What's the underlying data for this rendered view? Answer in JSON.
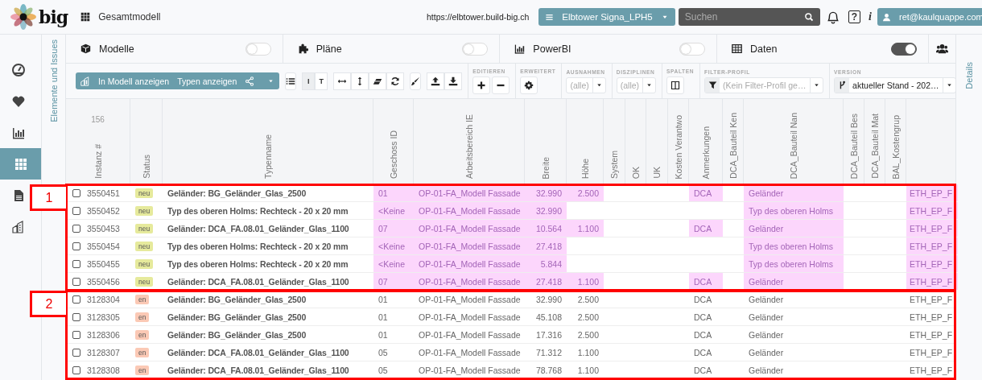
{
  "topbar": {
    "logo": "big",
    "context": "Gesamtmodell",
    "url": "https://elbtower.build-big.ch",
    "project": "Elbtower Signa_LPH5",
    "search": {
      "placeholder": "Suchen"
    },
    "help": "?",
    "info": "i",
    "user": "ret@kaulquappe.com"
  },
  "sidebar": {
    "items": [
      {
        "kind": "dashboard",
        "selected": false
      },
      {
        "kind": "favorites",
        "selected": false
      },
      {
        "kind": "charts",
        "selected": false
      },
      {
        "kind": "data",
        "selected": true
      },
      {
        "kind": "documents",
        "selected": false
      },
      {
        "kind": "buildings",
        "selected": false
      }
    ]
  },
  "left_tab": "Elemente und Issues",
  "right_tab": "Details",
  "panels": [
    {
      "kind": "models",
      "label": "Modelle",
      "on": false
    },
    {
      "kind": "plans",
      "label": "Pläne",
      "on": false
    },
    {
      "kind": "powerbi",
      "label": "PowerBI",
      "on": false
    },
    {
      "kind": "data",
      "label": "Daten",
      "on": true
    }
  ],
  "toolbar": {
    "view_buttons": [
      "In Modell anzeigen",
      "Typen anzeigen"
    ],
    "display_toggle": [
      {
        "label": "I",
        "selected": true
      },
      {
        "label": "T",
        "selected": false
      }
    ],
    "sections": [
      {
        "kind": "edit",
        "label": "EDITIEREN"
      },
      {
        "kind": "settings",
        "label": "ERWEITERT"
      },
      {
        "kind": "select",
        "label": "AUSNAHMEN",
        "value": "(alle)"
      },
      {
        "kind": "select",
        "label": "DISZIPLINEN",
        "value": "(alle)"
      },
      {
        "kind": "columns",
        "label": "SPALTEN"
      },
      {
        "kind": "filter",
        "label": "FILTER-PROFIL",
        "placeholder": "(Kein Filter-Profil ge…"
      },
      {
        "kind": "version",
        "label": "VERSION",
        "value": "aktueller Stand - 202…"
      }
    ]
  },
  "table": {
    "count": "156",
    "columns": [
      "Instanz #",
      "Status",
      "Typenname",
      "Geschoss ID",
      "Arbeitsbereich IE",
      "Breite",
      "Höhe",
      "System",
      "OK",
      "UK",
      "Kosten Verantwo",
      "Anmerkungen",
      "DCA_Bauteil Ken",
      "DCA_Bauteil Nan",
      "DCA_Bauteil Bes",
      "DCA_Bauteil Mat",
      "BAL_Kostengrup"
    ],
    "groups": [
      {
        "label": "1",
        "rows": [
          {
            "checked": false,
            "highlighted": true,
            "instanz": "3550451",
            "status": {
              "label": "neu",
              "color": "#e6ea9c"
            },
            "typenname": "Geländer: BG_Geländer_Glas_2500",
            "geschoss_id": "01",
            "arbeitsbereich": "OP-01-FA_Modell Fassade",
            "breite": "32.990",
            "hoehe": "2.500",
            "anmerkungen": "DCA",
            "dca_bauteil_name": "Geländer",
            "column_18": "ETH_EP_F"
          },
          {
            "checked": false,
            "highlighted": true,
            "instanz": "3550452",
            "status": {
              "label": "neu",
              "color": "#e6ea9c"
            },
            "typenname": "Typ des oberen Holms: Rechteck - 20 x 20 mm",
            "geschoss_id": "<Keine",
            "arbeitsbereich": "OP-01-FA_Modell Fassade",
            "breite": "32.990",
            "dca_bauteil_name": "Typ des oberen Holms",
            "column_18": "ETH_EP_F"
          },
          {
            "checked": false,
            "highlighted": true,
            "instanz": "3550453",
            "status": {
              "label": "neu",
              "color": "#e6ea9c"
            },
            "typenname": "Geländer: DCA_FA.08.01_Geländer_Glas_1100",
            "geschoss_id": "07",
            "arbeitsbereich": "OP-01-FA_Modell Fassade",
            "breite": "10.564",
            "hoehe": "1.100",
            "anmerkungen": "DCA",
            "dca_bauteil_name": "Geländer",
            "column_18": "ETH_EP_F"
          },
          {
            "checked": false,
            "highlighted": true,
            "instanz": "3550454",
            "status": {
              "label": "neu",
              "color": "#e6ea9c"
            },
            "typenname": "Typ des oberen Holms: Rechteck - 20 x 20 mm",
            "geschoss_id": "<Keine",
            "arbeitsbereich": "OP-01-FA_Modell Fassade",
            "breite": "27.418",
            "dca_bauteil_name": "Typ des oberen Holms",
            "column_18": "ETH_EP_F"
          },
          {
            "checked": false,
            "highlighted": true,
            "instanz": "3550455",
            "status": {
              "label": "neu",
              "color": "#e6ea9c"
            },
            "typenname": "Typ des oberen Holms: Rechteck - 20 x 20 mm",
            "geschoss_id": "<Keine",
            "arbeitsbereich": "OP-01-FA_Modell Fassade",
            "breite": "5.844",
            "dca_bauteil_name": "Typ des oberen Holms",
            "column_18": "ETH_EP_F"
          },
          {
            "checked": false,
            "highlighted": true,
            "instanz": "3550456",
            "status": {
              "label": "neu",
              "color": "#e6ea9c"
            },
            "typenname": "Geländer: DCA_FA.08.01_Geländer_Glas_1100",
            "geschoss_id": "07",
            "arbeitsbereich": "OP-01-FA_Modell Fassade",
            "breite": "27.418",
            "hoehe": "1.100",
            "anmerkungen": "DCA",
            "dca_bauteil_name": "Geländer",
            "column_18": "ETH_EP_F"
          }
        ]
      },
      {
        "label": "2",
        "rows": [
          {
            "checked": false,
            "highlighted": false,
            "instanz": "3128304",
            "status": {
              "label": "en",
              "color": "#fbc9b5"
            },
            "typenname": "Geländer: BG_Geländer_Glas_2500",
            "geschoss_id": "01",
            "arbeitsbereich": "OP-01-FA_Modell Fassade",
            "breite": "32.990",
            "hoehe": "2.500",
            "anmerkungen": "DCA",
            "dca_bauteil_name": "Geländer",
            "column_18": "ETH_EP_F"
          },
          {
            "checked": false,
            "highlighted": false,
            "instanz": "3128305",
            "status": {
              "label": "en",
              "color": "#fbc9b5"
            },
            "typenname": "Geländer: BG_Geländer_Glas_2500",
            "geschoss_id": "01",
            "arbeitsbereich": "OP-01-FA_Modell Fassade",
            "breite": "45.108",
            "hoehe": "2.500",
            "anmerkungen": "DCA",
            "dca_bauteil_name": "Geländer",
            "column_18": "ETH_EP_F"
          },
          {
            "checked": false,
            "highlighted": false,
            "instanz": "3128306",
            "status": {
              "label": "en",
              "color": "#fbc9b5"
            },
            "typenname": "Geländer: BG_Geländer_Glas_2500",
            "geschoss_id": "01",
            "arbeitsbereich": "OP-01-FA_Modell Fassade",
            "breite": "17.316",
            "hoehe": "2.500",
            "anmerkungen": "DCA",
            "dca_bauteil_name": "Geländer",
            "column_18": "ETH_EP_F"
          },
          {
            "checked": false,
            "highlighted": false,
            "instanz": "3128307",
            "status": {
              "label": "en",
              "color": "#fbc9b5"
            },
            "typenname": "Geländer: DCA_FA.08.01_Geländer_Glas_1100",
            "geschoss_id": "05",
            "arbeitsbereich": "OP-01-FA_Modell Fassade",
            "breite": "71.312",
            "hoehe": "1.100",
            "anmerkungen": "DCA",
            "dca_bauteil_name": "Geländer",
            "column_18": "ETH_EP_F"
          },
          {
            "checked": false,
            "highlighted": false,
            "instanz": "3128308",
            "status": {
              "label": "en",
              "color": "#fbc9b5"
            },
            "typenname": "Geländer: DCA_FA.08.01_Geländer_Glas_1100",
            "geschoss_id": "05",
            "arbeitsbereich": "OP-01-FA_Modell Fassade",
            "breite": "78.768",
            "hoehe": "1.100",
            "anmerkungen": "DCA",
            "dca_bauteil_name": "Geländer",
            "column_18": "ETH_EP_F"
          }
        ]
      }
    ]
  }
}
